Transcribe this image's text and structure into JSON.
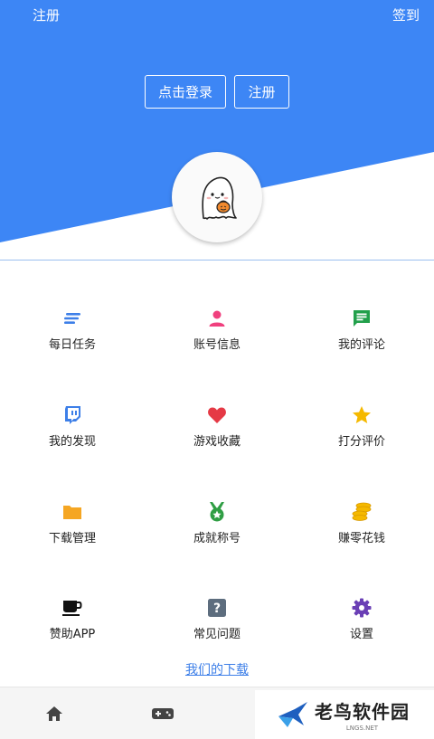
{
  "header": {
    "top_left": "注册",
    "top_right": "签到",
    "login_button": "点击登录",
    "register_button": "注册",
    "accent_color": "#3d7fe8"
  },
  "menu": [
    {
      "label": "每日任务",
      "icon": "list-icon",
      "color": "#3d7fe8"
    },
    {
      "label": "账号信息",
      "icon": "person-icon",
      "color": "#f0407e"
    },
    {
      "label": "我的评论",
      "icon": "comment-icon",
      "color": "#22a04b"
    },
    {
      "label": "我的发现",
      "icon": "twitch-icon",
      "color": "#3d7fe8"
    },
    {
      "label": "游戏收藏",
      "icon": "heart-icon",
      "color": "#e53945"
    },
    {
      "label": "打分评价",
      "icon": "star-icon",
      "color": "#f5b900"
    },
    {
      "label": "下载管理",
      "icon": "folder-icon",
      "color": "#f5a623"
    },
    {
      "label": "成就称号",
      "icon": "medal-icon",
      "color": "#2f9e44"
    },
    {
      "label": "赚零花钱",
      "icon": "coins-icon",
      "color": "#f5b900"
    },
    {
      "label": "赞助APP",
      "icon": "coffee-icon",
      "color": "#111111"
    },
    {
      "label": "常见问题",
      "icon": "question-icon",
      "color": "#5d6d7e"
    },
    {
      "label": "设置",
      "icon": "gear-icon",
      "color": "#6a3fb5"
    }
  ],
  "download_link": "我们的下载",
  "tabbar": {
    "items": [
      {
        "icon": "home-icon"
      },
      {
        "icon": "gamepad-icon"
      }
    ]
  },
  "watermark": {
    "title": "老鸟软件园",
    "subtitle": "LNGS.NET"
  }
}
